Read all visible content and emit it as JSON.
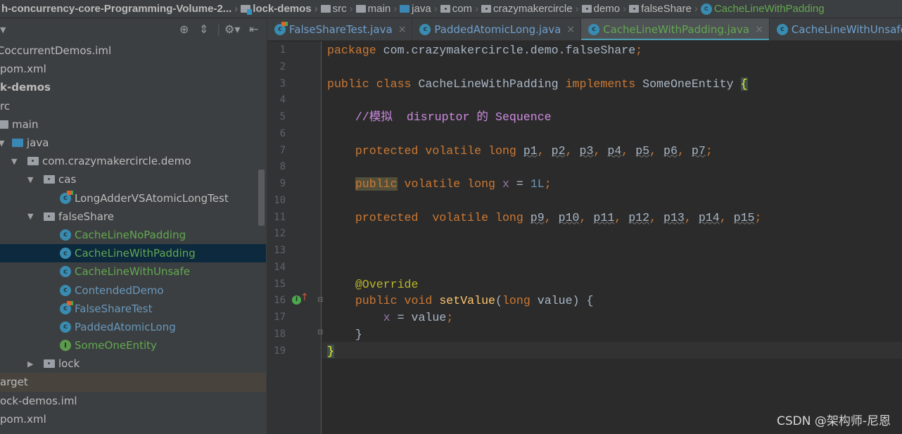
{
  "breadcrumb": [
    {
      "label": "h-concurrency-core-Programming-Volume-2...",
      "icon": "none",
      "bold": true
    },
    {
      "label": "lock-demos",
      "icon": "module-folder-icon",
      "bold": true
    },
    {
      "label": "src",
      "icon": "folder-icon"
    },
    {
      "label": "main",
      "icon": "folder-icon"
    },
    {
      "label": "java",
      "icon": "source-folder-icon"
    },
    {
      "label": "com",
      "icon": "package-icon"
    },
    {
      "label": "crazymakercircle",
      "icon": "package-icon"
    },
    {
      "label": "demo",
      "icon": "package-icon"
    },
    {
      "label": "falseShare",
      "icon": "package-icon"
    },
    {
      "label": "CacheLineWithPadding",
      "icon": "class-icon"
    }
  ],
  "tree": [
    {
      "label": "CoccurrentDemos.iml"
    },
    {
      "label": "pom.xml"
    },
    {
      "label": "k-demos"
    },
    {
      "label": "rc"
    },
    {
      "label": "main"
    },
    {
      "label": "java"
    },
    {
      "label": "com.crazymakercircle.demo"
    },
    {
      "label": "cas"
    },
    {
      "label": "LongAdderVSAtomicLongTest"
    },
    {
      "label": "falseShare"
    },
    {
      "label": "CacheLineNoPadding"
    },
    {
      "label": "CacheLineWithPadding"
    },
    {
      "label": "CacheLineWithUnsafe"
    },
    {
      "label": "ContendedDemo"
    },
    {
      "label": "FalseShareTest"
    },
    {
      "label": "PaddedAtomicLong"
    },
    {
      "label": "SomeOneEntity"
    },
    {
      "label": "lock"
    },
    {
      "label": "arget"
    },
    {
      "label": "ock-demos.iml"
    },
    {
      "label": "pom.xml"
    }
  ],
  "tabs": [
    {
      "label": "FalseShareTest.java",
      "close": "×"
    },
    {
      "label": "PaddedAtomicLong.java",
      "close": "×"
    },
    {
      "label": "CacheLineWithPadding.java",
      "close": "×"
    },
    {
      "label": "CacheLineWithUnsafe.java",
      "close": ""
    }
  ],
  "class_icon_letter": "c",
  "interface_icon_letter": "I",
  "code": [
    [
      [
        "package ",
        "kw"
      ],
      [
        "com.crazymakercircle.demo.falseShare",
        "id"
      ],
      [
        ";",
        "kw"
      ]
    ],
    [],
    [
      [
        "public class ",
        "kw"
      ],
      [
        "CacheLineWithPadding ",
        "id"
      ],
      [
        "implements ",
        "kw"
      ],
      [
        "SomeOneEntity ",
        "id"
      ],
      [
        "{",
        "brace"
      ]
    ],
    [],
    [
      [
        "    //模拟  disruptor 的 Sequence",
        "cmt"
      ]
    ],
    [],
    [
      [
        "    protected volatile long ",
        "kw"
      ],
      [
        "p1",
        "unused"
      ],
      [
        ", ",
        "kw"
      ],
      [
        "p2",
        "unused"
      ],
      [
        ", ",
        "kw"
      ],
      [
        "p3",
        "unused"
      ],
      [
        ", ",
        "kw"
      ],
      [
        "p4",
        "unused"
      ],
      [
        ", ",
        "kw"
      ],
      [
        "p5",
        "unused"
      ],
      [
        ", ",
        "kw"
      ],
      [
        "p6",
        "unused"
      ],
      [
        ", ",
        "kw"
      ],
      [
        "p7",
        "unused"
      ],
      [
        ";",
        "kw"
      ]
    ],
    [],
    [
      [
        "    ",
        "id"
      ],
      [
        "public",
        "kw hl"
      ],
      [
        " volatile long ",
        "kw"
      ],
      [
        "x",
        "fld"
      ],
      [
        " = ",
        "id"
      ],
      [
        "1L",
        "num"
      ],
      [
        ";",
        "kw"
      ]
    ],
    [],
    [
      [
        "    protected  volatile long ",
        "kw"
      ],
      [
        "p9",
        "unused"
      ],
      [
        ", ",
        "kw"
      ],
      [
        "p10",
        "unused"
      ],
      [
        ", ",
        "kw"
      ],
      [
        "p11",
        "unused"
      ],
      [
        ", ",
        "kw"
      ],
      [
        "p12",
        "unused"
      ],
      [
        ", ",
        "kw"
      ],
      [
        "p13",
        "unused"
      ],
      [
        ", ",
        "kw"
      ],
      [
        "p14",
        "unused"
      ],
      [
        ", ",
        "kw"
      ],
      [
        "p15",
        "unused"
      ],
      [
        ";",
        "kw"
      ]
    ],
    [],
    [],
    [],
    [
      [
        "    @Override",
        "ann"
      ]
    ],
    [
      [
        "    public void ",
        "kw"
      ],
      [
        "setValue",
        "fn"
      ],
      [
        "(",
        "id"
      ],
      [
        "long ",
        "kw"
      ],
      [
        "value) {",
        "id"
      ]
    ],
    [
      [
        "        ",
        "id"
      ],
      [
        "x",
        "fld"
      ],
      [
        " = value",
        "id"
      ],
      [
        ";",
        "kw"
      ]
    ],
    [
      [
        "    }",
        "id"
      ]
    ],
    [
      [
        "}",
        "brace"
      ]
    ]
  ],
  "watermark": "CSDN @架构师-尼恩",
  "colors": {
    "accent": "#4a9fb4",
    "selection": "#0d293e",
    "editor_bg": "#2b2b2b",
    "sidebar_bg": "#3c3f41"
  }
}
